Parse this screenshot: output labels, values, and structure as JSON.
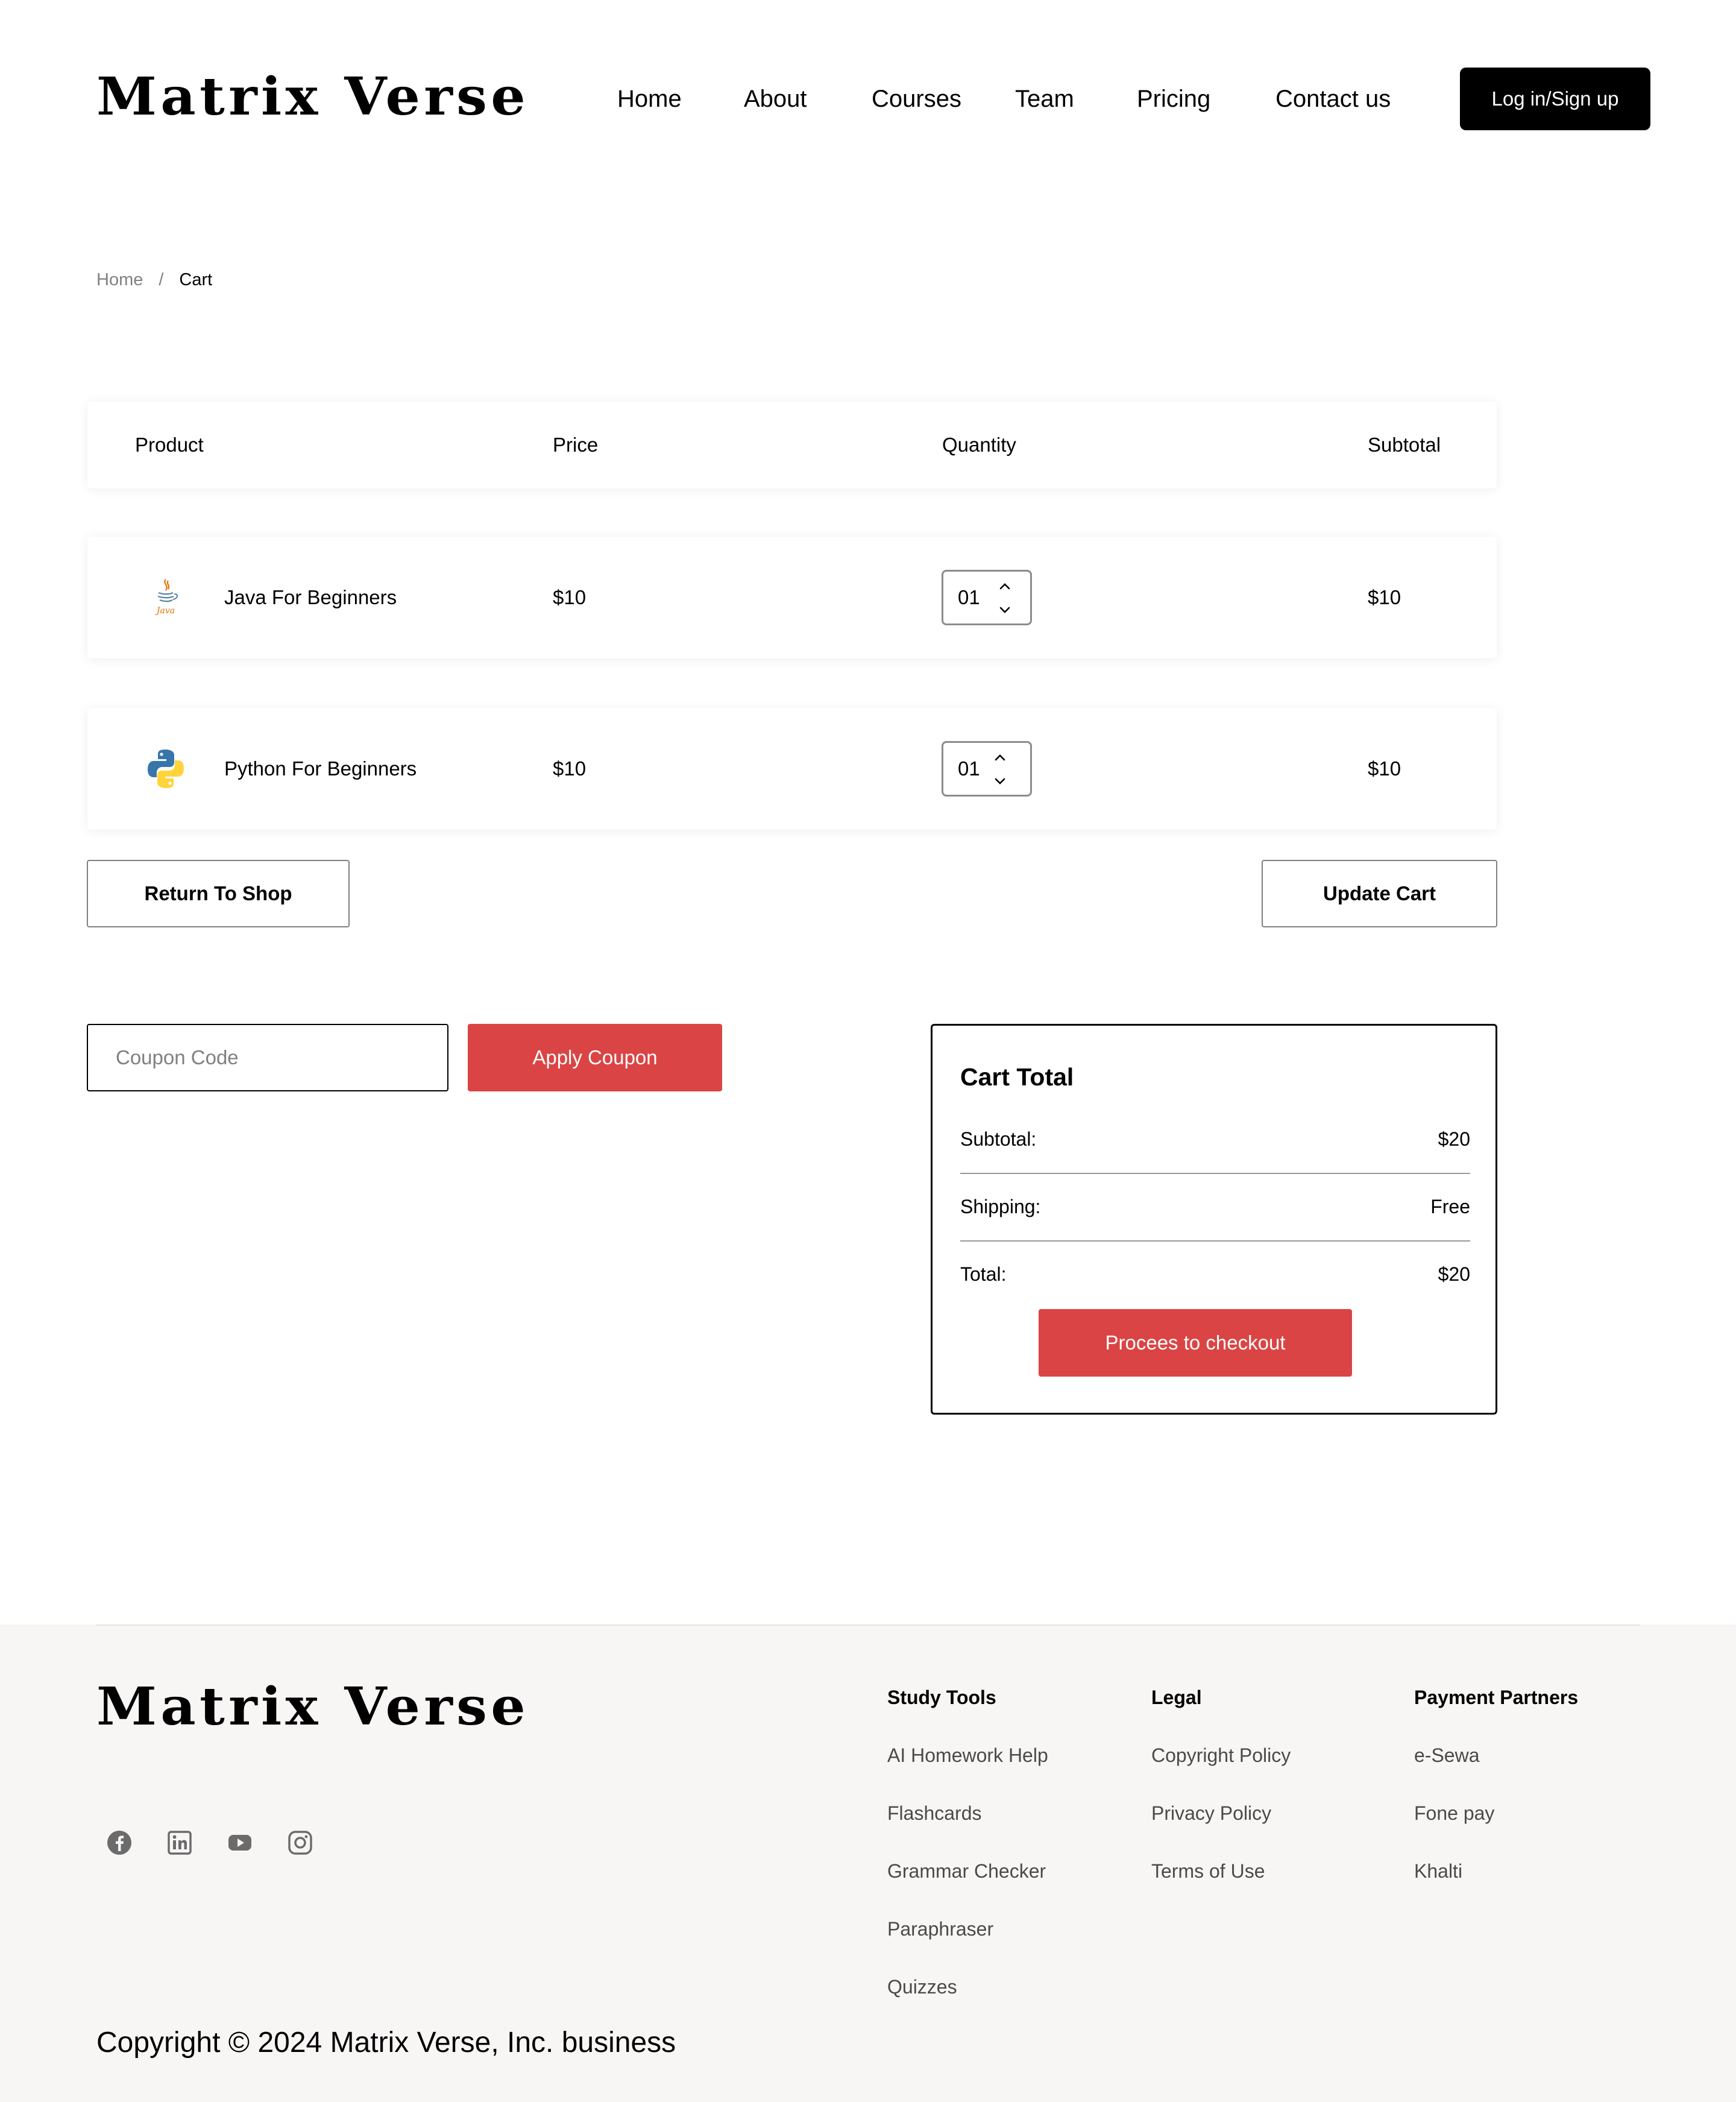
{
  "brand": {
    "name": "Matrix Verse"
  },
  "nav": {
    "items": [
      {
        "label": "Home"
      },
      {
        "label": "About"
      },
      {
        "label": "Courses"
      },
      {
        "label": "Team"
      },
      {
        "label": "Pricing"
      },
      {
        "label": "Contact us"
      }
    ],
    "login_label": "Log in/Sign up"
  },
  "breadcrumb": {
    "home": "Home",
    "separator": "/",
    "current": "Cart"
  },
  "cart": {
    "headers": {
      "product": "Product",
      "price": "Price",
      "quantity": "Quantity",
      "subtotal": "Subtotal"
    },
    "items": [
      {
        "name": "Java For Beginners",
        "icon": "java-logo-icon",
        "price": "$10",
        "quantity": "01",
        "subtotal": "$10"
      },
      {
        "name": "Python For Beginners",
        "icon": "python-logo-icon",
        "price": "$10",
        "quantity": "01",
        "subtotal": "$10"
      }
    ],
    "return_label": "Return To Shop",
    "update_label": "Update Cart"
  },
  "coupon": {
    "placeholder": "Coupon Code",
    "value": "",
    "apply_label": "Apply Coupon"
  },
  "totals": {
    "title": "Cart Total",
    "subtotal_label": "Subtotal:",
    "subtotal_value": "$20",
    "shipping_label": "Shipping:",
    "shipping_value": "Free",
    "total_label": "Total:",
    "total_value": "$20",
    "checkout_label": "Procees to checkout"
  },
  "footer": {
    "socials": [
      "facebook-icon",
      "linkedin-icon",
      "youtube-icon",
      "instagram-icon"
    ],
    "columns": [
      {
        "heading": "Study Tools",
        "links": [
          "AI Homework Help",
          "Flashcards",
          "Grammar Checker",
          "Paraphraser",
          "Quizzes"
        ]
      },
      {
        "heading": "Legal",
        "links": [
          "Copyright Policy",
          "Privacy Policy",
          "Terms of Use"
        ]
      },
      {
        "heading": "Payment Partners",
        "links": [
          "e-Sewa",
          "Fone pay",
          "Khalti"
        ]
      }
    ],
    "copyright": "Copyright © 2024 Matrix Verse, Inc. business"
  },
  "colors": {
    "accent": "#DB4444",
    "primary": "#000000",
    "footer_bg": "#F8F5F5"
  }
}
